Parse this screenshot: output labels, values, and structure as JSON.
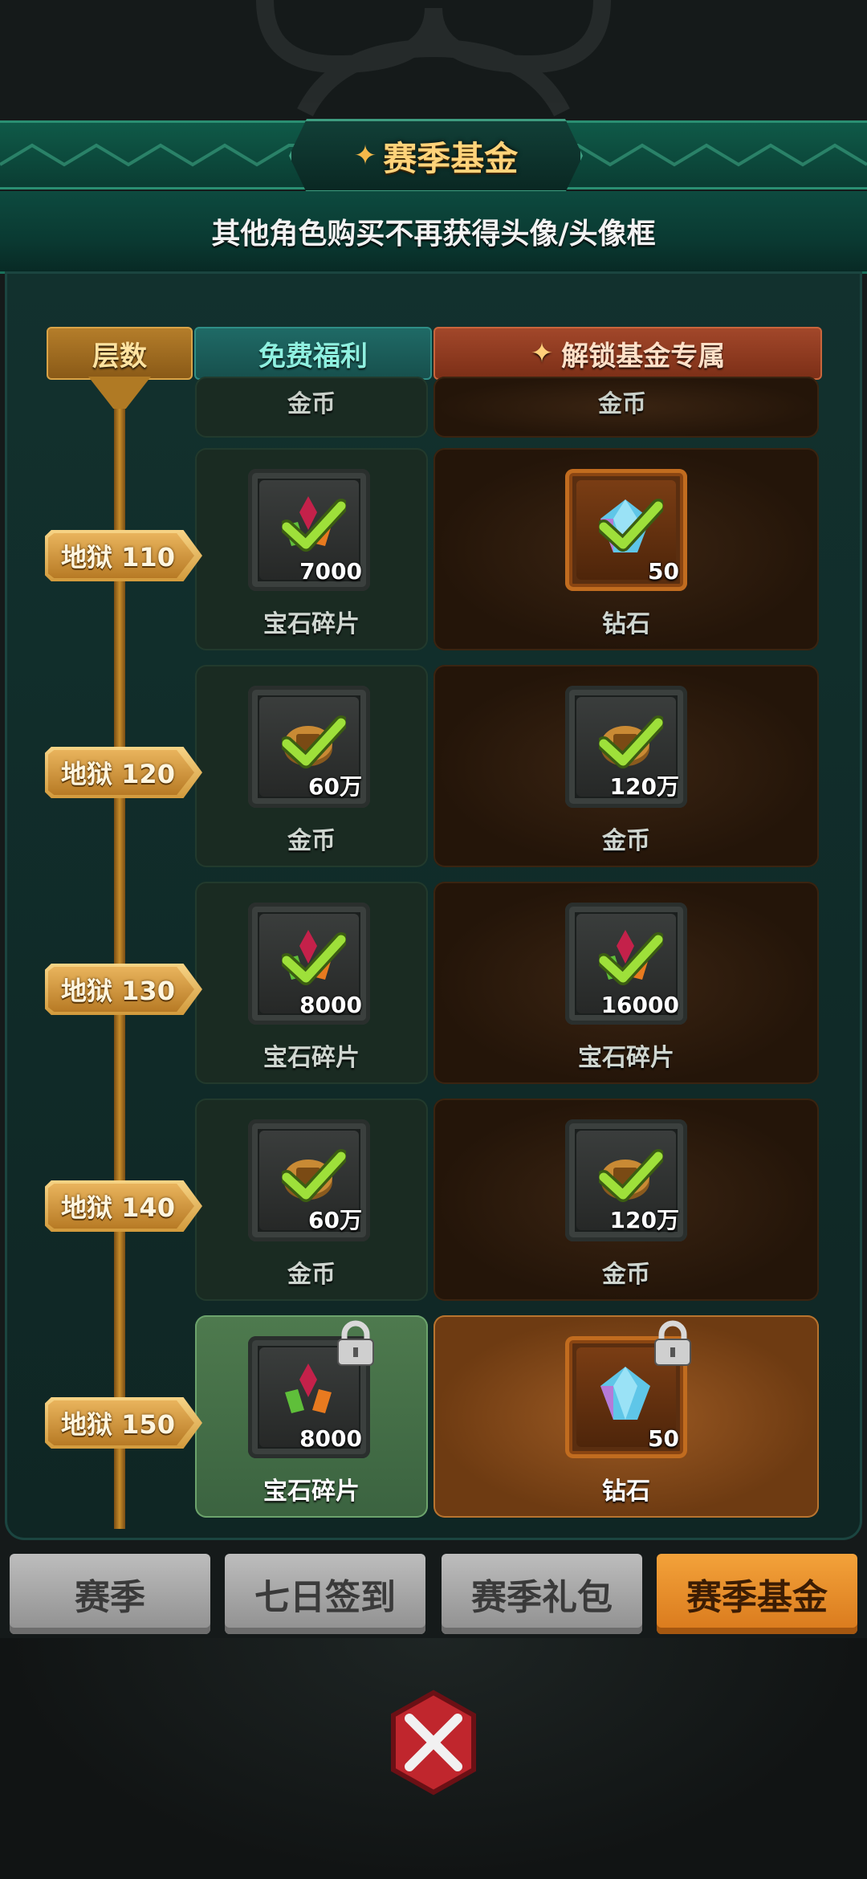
{
  "header": {
    "title": "赛季基金"
  },
  "subtitle": "其他角色购买不再获得头像/头像框",
  "columns": {
    "layer": "层数",
    "free": "免费福利",
    "fund": "解锁基金专属"
  },
  "top_partial": {
    "free_label": "金币",
    "fund_label": "金币"
  },
  "rows": [
    {
      "layer": "地狱 110",
      "free": {
        "icon": "gem-shard-icon",
        "qty": "7000",
        "label": "宝石碎片",
        "claimed": true
      },
      "fund": {
        "icon": "diamond-icon",
        "qty": "50",
        "label": "钻石",
        "claimed": true
      }
    },
    {
      "layer": "地狱 120",
      "free": {
        "icon": "coin-icon",
        "qty": "60万",
        "label": "金币",
        "claimed": true
      },
      "fund": {
        "icon": "coin-icon",
        "qty": "120万",
        "label": "金币",
        "claimed": true
      }
    },
    {
      "layer": "地狱 130",
      "free": {
        "icon": "gem-shard-icon",
        "qty": "8000",
        "label": "宝石碎片",
        "claimed": true
      },
      "fund": {
        "icon": "gem-shard-icon",
        "qty": "16000",
        "label": "宝石碎片",
        "claimed": true
      }
    },
    {
      "layer": "地狱 140",
      "free": {
        "icon": "coin-icon",
        "qty": "60万",
        "label": "金币",
        "claimed": true
      },
      "fund": {
        "icon": "coin-icon",
        "qty": "120万",
        "label": "金币",
        "claimed": true
      }
    },
    {
      "layer": "地狱 150",
      "free": {
        "icon": "gem-shard-icon",
        "qty": "8000",
        "label": "宝石碎片",
        "locked": true
      },
      "fund": {
        "icon": "diamond-icon",
        "qty": "50",
        "label": "钻石",
        "locked": true
      }
    }
  ],
  "tabs": [
    {
      "label": "赛季",
      "selected": false
    },
    {
      "label": "七日签到",
      "selected": false
    },
    {
      "label": "赛季礼包",
      "selected": false
    },
    {
      "label": "赛季基金",
      "selected": true
    }
  ],
  "colors": {
    "accent_gold": "#ffd37a",
    "teal": "#0f5a48",
    "tab_selected": "#f3a23a"
  }
}
